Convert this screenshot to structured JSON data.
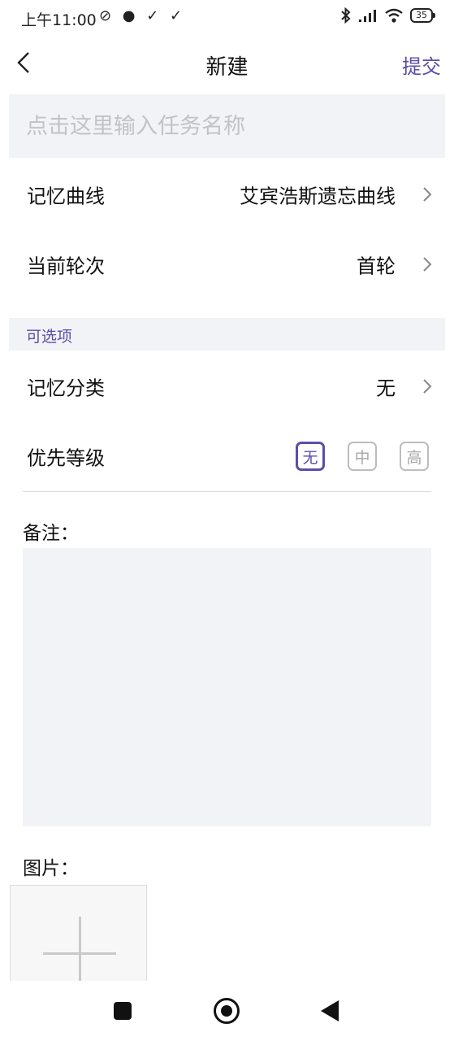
{
  "status_bar": {
    "time": "上午11:00",
    "notification_icons": "⊘ ● ✓ ✓",
    "battery": "35"
  },
  "nav": {
    "title": "新建",
    "submit_label": "提交"
  },
  "task_input": {
    "placeholder": "点击这里输入任务名称",
    "value": ""
  },
  "rows": {
    "memory_curve": {
      "label": "记忆曲线",
      "value": "艾宾浩斯遗忘曲线"
    },
    "current_round": {
      "label": "当前轮次",
      "value": "首轮"
    }
  },
  "optional_section": {
    "header": "可选项",
    "memory_category": {
      "label": "记忆分类",
      "value": "无"
    },
    "priority": {
      "label": "优先等级",
      "options": [
        "无",
        "中",
        "高"
      ],
      "selected": "无"
    }
  },
  "notes": {
    "label": "备注：",
    "value": ""
  },
  "images": {
    "label": "图片："
  },
  "colors": {
    "accent": "#5b4ea8",
    "field_background": "#f2f3f6",
    "placeholder": "#c0c3c8"
  },
  "icons": {
    "back": "chevron-left-icon",
    "row_arrow": "chevron-right-icon",
    "add_image": "plus-icon",
    "bluetooth": "bluetooth-icon",
    "signal": "signal-icon",
    "wifi": "wifi-icon",
    "battery": "battery-icon"
  }
}
